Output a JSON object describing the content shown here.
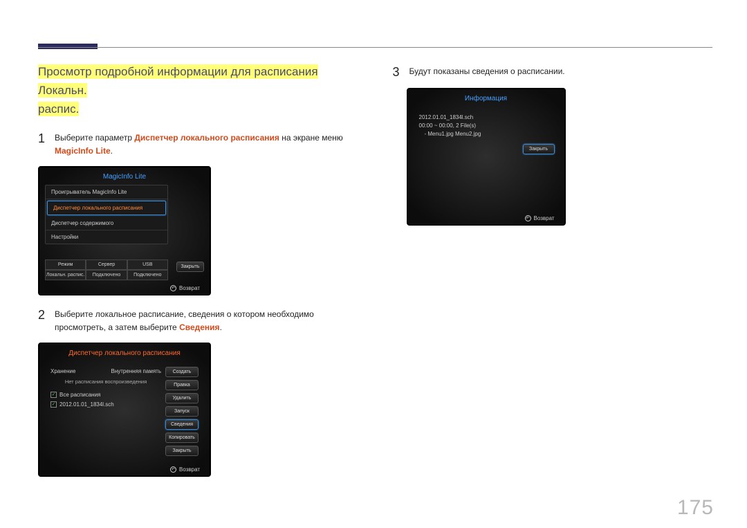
{
  "page_number": "175",
  "title_lines": [
    "Просмотр подробной информации для расписания Локальн.",
    "распис."
  ],
  "steps": {
    "s1": {
      "num": "1",
      "pre": "Выберите параметр ",
      "hl": "Диспетчер локального расписания",
      "mid": " на экране меню ",
      "hl2": "MagicInfo Lite",
      "post": "."
    },
    "s2": {
      "num": "2",
      "pre": "Выберите локальное расписание, сведения о котором необходимо просмотреть, а затем выберите ",
      "hl": "Сведения",
      "post": "."
    },
    "s3": {
      "num": "3",
      "text": "Будут показаны сведения о расписании."
    }
  },
  "panel1": {
    "title": "MagicInfo Lite",
    "items": [
      "Проигрыватель MagicInfo Lite",
      "Диспетчер локального расписания",
      "Диспетчер содержимого",
      "Настройки"
    ],
    "close": "Закрыть",
    "status_headers": [
      "Режим",
      "Сервер",
      "USB"
    ],
    "status_values": [
      "Локальн. распис.",
      "Подключено",
      "Подключено"
    ],
    "return": "Возврат"
  },
  "panel2": {
    "title": "Диспетчер локального расписания",
    "storage_label": "Хранение",
    "storage_value": "Внутренняя память",
    "empty_note": "Нет расписания воспроизведения",
    "all": "Все расписания",
    "item": "2012.01.01_1834l.sch",
    "buttons": [
      "Создать",
      "Правка",
      "Удалить",
      "Запуск",
      "Сведения",
      "Копировать",
      "Закрыть"
    ],
    "return": "Возврат"
  },
  "panel3": {
    "title": "Информация",
    "line1": "2012.01.01_1834l.sch",
    "line2": "00:00 ~ 00:00, 2 File(s)",
    "line3": "- Menu1.jpg Menu2.jpg",
    "close": "Закрыть",
    "return": "Возврат"
  }
}
